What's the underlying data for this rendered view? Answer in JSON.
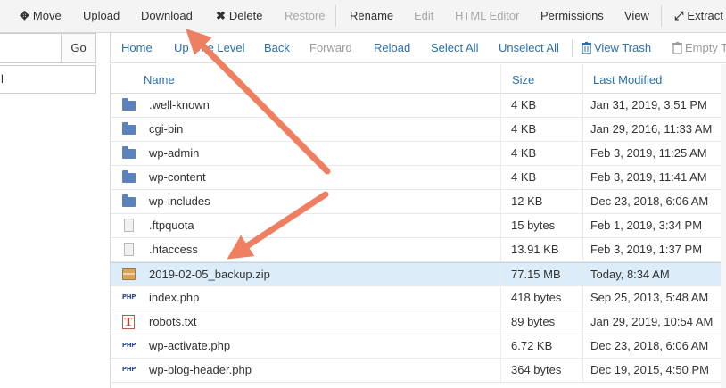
{
  "toolbar": {
    "buttons": [
      {
        "label": "Move",
        "icon": "move-icon",
        "glyph": "✥",
        "enabled": true
      },
      {
        "label": "Upload",
        "enabled": true
      },
      {
        "label": "Download",
        "enabled": true
      },
      {
        "label": "Delete",
        "icon": "delete-icon",
        "glyph": "✖",
        "enabled": true
      },
      {
        "label": "Restore",
        "enabled": false
      },
      {
        "label": "Rename",
        "enabled": true
      },
      {
        "label": "Edit",
        "enabled": false
      },
      {
        "label": "HTML Editor",
        "enabled": false
      },
      {
        "label": "Permissions",
        "enabled": true
      },
      {
        "label": "View",
        "enabled": true
      },
      {
        "label": "Extract",
        "icon": "extract-icon",
        "glyph": "⤢",
        "enabled": true
      }
    ]
  },
  "left_panel": {
    "go_label": "Go",
    "tree_text": "l"
  },
  "navbar": {
    "home": "Home",
    "up_one_level": "Up One Level",
    "back": "Back",
    "forward": "Forward",
    "reload": "Reload",
    "select_all": "Select All",
    "unselect_all": "Unselect All",
    "view_trash": "View Trash",
    "empty_trash": "Empty T"
  },
  "table": {
    "headers": {
      "name": "Name",
      "size": "Size",
      "last_modified": "Last Modified"
    },
    "rows": [
      {
        "icon": "folder-icon",
        "name": ".well-known",
        "size": "4 KB",
        "modified": "Jan 31, 2019, 3:51 PM",
        "selected": false
      },
      {
        "icon": "folder-icon",
        "name": "cgi-bin",
        "size": "4 KB",
        "modified": "Jan 29, 2016, 11:33 AM",
        "selected": false
      },
      {
        "icon": "folder-icon",
        "name": "wp-admin",
        "size": "4 KB",
        "modified": "Feb 3, 2019, 11:25 AM",
        "selected": false
      },
      {
        "icon": "folder-icon",
        "name": "wp-content",
        "size": "4 KB",
        "modified": "Feb 3, 2019, 11:41 AM",
        "selected": false
      },
      {
        "icon": "folder-icon",
        "name": "wp-includes",
        "size": "12 KB",
        "modified": "Dec 23, 2018, 6:06 AM",
        "selected": false
      },
      {
        "icon": "file-icon",
        "name": ".ftpquota",
        "size": "15 bytes",
        "modified": "Feb 1, 2019, 3:34 PM",
        "selected": false
      },
      {
        "icon": "file-icon",
        "name": ".htaccess",
        "size": "13.91 KB",
        "modified": "Feb 3, 2019, 1:37 PM",
        "selected": false
      },
      {
        "icon": "zip-icon",
        "name": "2019-02-05_backup.zip",
        "size": "77.15 MB",
        "modified": "Today, 8:34 AM",
        "selected": true
      },
      {
        "icon": "php-icon",
        "name": "index.php",
        "size": "418 bytes",
        "modified": "Sep 25, 2013, 5:48 AM",
        "selected": false
      },
      {
        "icon": "txt-icon",
        "name": "robots.txt",
        "size": "89 bytes",
        "modified": "Jan 29, 2019, 10:54 AM",
        "selected": false
      },
      {
        "icon": "php-icon",
        "name": "wp-activate.php",
        "size": "6.72 KB",
        "modified": "Dec 23, 2018, 6:06 AM",
        "selected": false
      },
      {
        "icon": "php-icon",
        "name": "wp-blog-header.php",
        "size": "364 bytes",
        "modified": "Dec 19, 2015, 4:50 PM",
        "selected": false
      }
    ]
  },
  "colors": {
    "link": "#2a6fad",
    "selected_row": "#dcecf8",
    "arrow": "#ee8061",
    "folder": "#5b82bd"
  }
}
